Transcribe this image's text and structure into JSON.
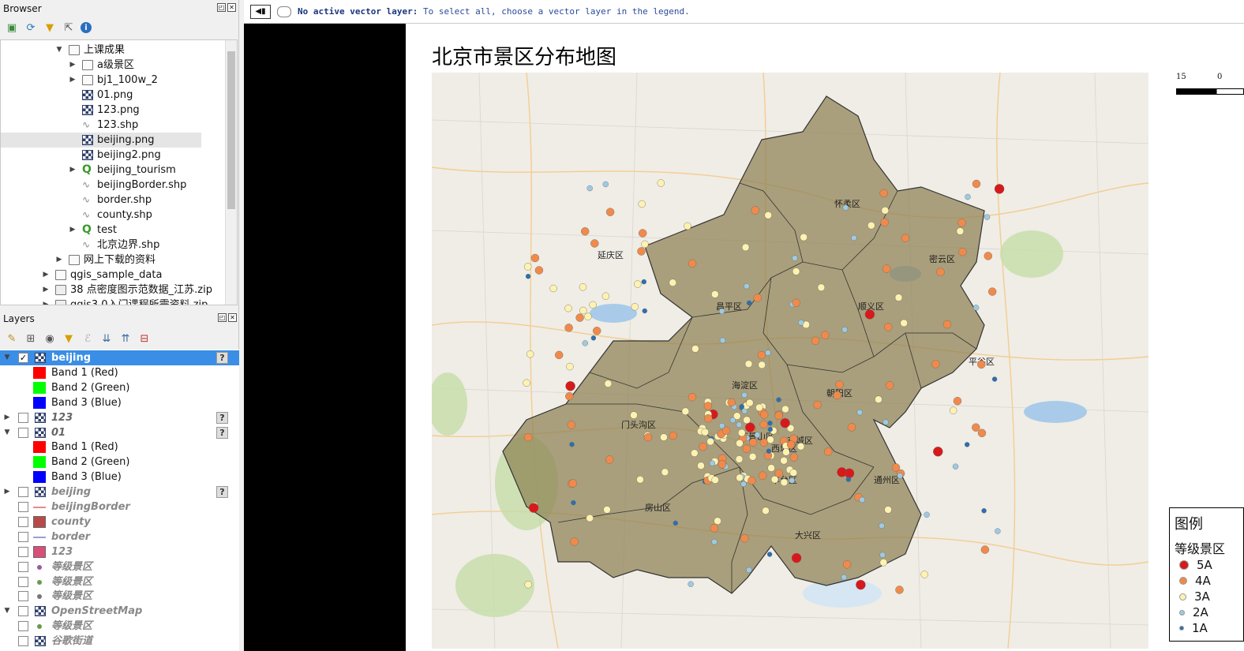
{
  "browser": {
    "title": "Browser",
    "items": [
      {
        "label": "上课成果",
        "type": "folder",
        "expand": "down",
        "indent": 1
      },
      {
        "label": "a级景区",
        "type": "folder",
        "expand": "right",
        "indent": 2
      },
      {
        "label": "bj1_100w_2",
        "type": "folder",
        "expand": "right",
        "indent": 2
      },
      {
        "label": "01.png",
        "type": "raster",
        "expand": "",
        "indent": 2
      },
      {
        "label": "123.png",
        "type": "raster",
        "expand": "",
        "indent": 2
      },
      {
        "label": "123.shp",
        "type": "vector",
        "expand": "",
        "indent": 2
      },
      {
        "label": "beijing.png",
        "type": "raster",
        "expand": "",
        "indent": 2
      },
      {
        "label": "beijing2.png",
        "type": "raster",
        "expand": "",
        "indent": 2
      },
      {
        "label": "beijing_tourism",
        "type": "qgs",
        "expand": "right",
        "indent": 2
      },
      {
        "label": "beijingBorder.shp",
        "type": "vector",
        "expand": "",
        "indent": 2
      },
      {
        "label": "border.shp",
        "type": "vector",
        "expand": "",
        "indent": 2
      },
      {
        "label": "county.shp",
        "type": "vector",
        "expand": "",
        "indent": 2
      },
      {
        "label": "test",
        "type": "qgs",
        "expand": "right",
        "indent": 2
      },
      {
        "label": "北京边界.shp",
        "type": "vector",
        "expand": "",
        "indent": 2
      },
      {
        "label": "网上下载的资料",
        "type": "folder",
        "expand": "right",
        "indent": 1
      },
      {
        "label": "qgis_sample_data",
        "type": "folder",
        "expand": "right",
        "indent": 0
      },
      {
        "label": "38 点密度图示范数据_江苏.zip",
        "type": "zip",
        "expand": "right",
        "indent": 0
      },
      {
        "label": "qgis3.0入门课程所需资料.zip",
        "type": "zip",
        "expand": "right",
        "indent": 0
      }
    ]
  },
  "layers": {
    "title": "Layers",
    "items": [
      {
        "label": "beijing",
        "kind": "raster",
        "expand": "down",
        "checked": true,
        "selected": true,
        "help": true,
        "style": "bold"
      },
      {
        "label": "Band 1 (Red)",
        "kind": "swatch",
        "color": "#ff0000",
        "child": true
      },
      {
        "label": "Band 2 (Green)",
        "kind": "swatch",
        "color": "#00ff00",
        "child": true
      },
      {
        "label": "Band 3 (Blue)",
        "kind": "swatch",
        "color": "#0000ff",
        "child": true
      },
      {
        "label": "123",
        "kind": "raster",
        "expand": "right",
        "checked": false,
        "help": true,
        "style": "italic"
      },
      {
        "label": "01",
        "kind": "raster",
        "expand": "down",
        "checked": false,
        "help": true,
        "style": "italic"
      },
      {
        "label": "Band 1 (Red)",
        "kind": "swatch",
        "color": "#ff0000",
        "child": true
      },
      {
        "label": "Band 2 (Green)",
        "kind": "swatch",
        "color": "#00ff00",
        "child": true
      },
      {
        "label": "Band 3 (Blue)",
        "kind": "swatch",
        "color": "#0000ff",
        "child": true
      },
      {
        "label": "beijing",
        "kind": "raster",
        "expand": "right",
        "checked": false,
        "help": true,
        "style": "dim"
      },
      {
        "label": "beijingBorder",
        "kind": "line",
        "color": "#e88a8a",
        "checked": false,
        "style": "dim"
      },
      {
        "label": "county",
        "kind": "fill",
        "color": "#b84a4a",
        "checked": false,
        "style": "dim"
      },
      {
        "label": "border",
        "kind": "line",
        "color": "#9aa0d0",
        "checked": false,
        "style": "dim"
      },
      {
        "label": "123",
        "kind": "fill",
        "color": "#d94f7a",
        "checked": false,
        "style": "dim"
      },
      {
        "label": "等级景区",
        "kind": "point",
        "color": "#9a5aa0",
        "checked": false,
        "style": "dim"
      },
      {
        "label": "等级景区",
        "kind": "point",
        "color": "#6a9a4a",
        "checked": false,
        "style": "dim"
      },
      {
        "label": "等级景区",
        "kind": "point",
        "color": "#777777",
        "checked": false,
        "style": "dim"
      },
      {
        "label": "OpenStreetMap",
        "kind": "raster",
        "expand": "down",
        "checked": false,
        "style": "dim"
      },
      {
        "label": "等级景区",
        "kind": "point",
        "color": "#6a9a4a",
        "checked": false,
        "style": "dim",
        "child2": true
      },
      {
        "label": "谷歌街道",
        "kind": "raster",
        "expand": "",
        "checked": false,
        "style": "dim",
        "child2": true
      }
    ]
  },
  "message": {
    "bold": "No active vector layer:",
    "text": " To select all, choose a vector layer in the legend."
  },
  "layout": {
    "title": "北京市景区分布地图",
    "scale": {
      "left": "15",
      "right": "0"
    },
    "legend": {
      "title": "图例",
      "subtitle": "等级景区",
      "items": [
        {
          "label": "5A",
          "color": "#d7191c",
          "size": 12
        },
        {
          "label": "4A",
          "color": "#f08a4b",
          "size": 10
        },
        {
          "label": "3A",
          "color": "#fff2b0",
          "size": 9
        },
        {
          "label": "2A",
          "color": "#9ecae1",
          "size": 7
        },
        {
          "label": "1A",
          "color": "#2c6fb0",
          "size": 6
        }
      ]
    },
    "district_labels": [
      "延庆区",
      "怀柔区",
      "密云区",
      "平谷区",
      "昌平区",
      "顺义区",
      "门头沟区",
      "海淀区",
      "朝阳区",
      "石景山区",
      "丰台区",
      "房山区",
      "大兴区",
      "通州区",
      "东城区",
      "西城区"
    ]
  }
}
